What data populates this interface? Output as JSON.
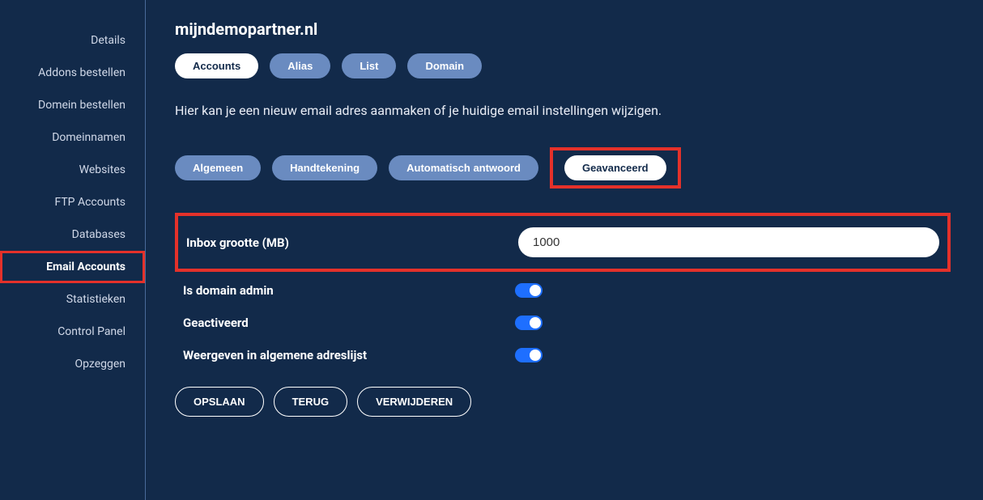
{
  "sidebar": {
    "items": [
      {
        "label": "Details"
      },
      {
        "label": "Addons bestellen"
      },
      {
        "label": "Domein bestellen"
      },
      {
        "label": "Domeinnamen"
      },
      {
        "label": "Websites"
      },
      {
        "label": "FTP Accounts"
      },
      {
        "label": "Databases"
      },
      {
        "label": "Email Accounts"
      },
      {
        "label": "Statistieken"
      },
      {
        "label": "Control Panel"
      },
      {
        "label": "Opzeggen"
      }
    ]
  },
  "page": {
    "title": "mijndemopartner.nl",
    "description": "Hier kan je een nieuw email adres aanmaken of je huidige email instellingen wijzigen."
  },
  "topTabs": [
    {
      "label": "Accounts"
    },
    {
      "label": "Alias"
    },
    {
      "label": "List"
    },
    {
      "label": "Domain"
    }
  ],
  "subTabs": [
    {
      "label": "Algemeen"
    },
    {
      "label": "Handtekening"
    },
    {
      "label": "Automatisch antwoord"
    },
    {
      "label": "Geavanceerd"
    }
  ],
  "form": {
    "inboxSize": {
      "label": "Inbox grootte (MB)",
      "value": "1000"
    },
    "isDomainAdmin": {
      "label": "Is domain admin"
    },
    "activated": {
      "label": "Geactiveerd"
    },
    "showInGlobalList": {
      "label": "Weergeven in algemene adreslijst"
    }
  },
  "actions": {
    "save": "OPSLAAN",
    "back": "TERUG",
    "delete": "VERWIJDEREN"
  }
}
